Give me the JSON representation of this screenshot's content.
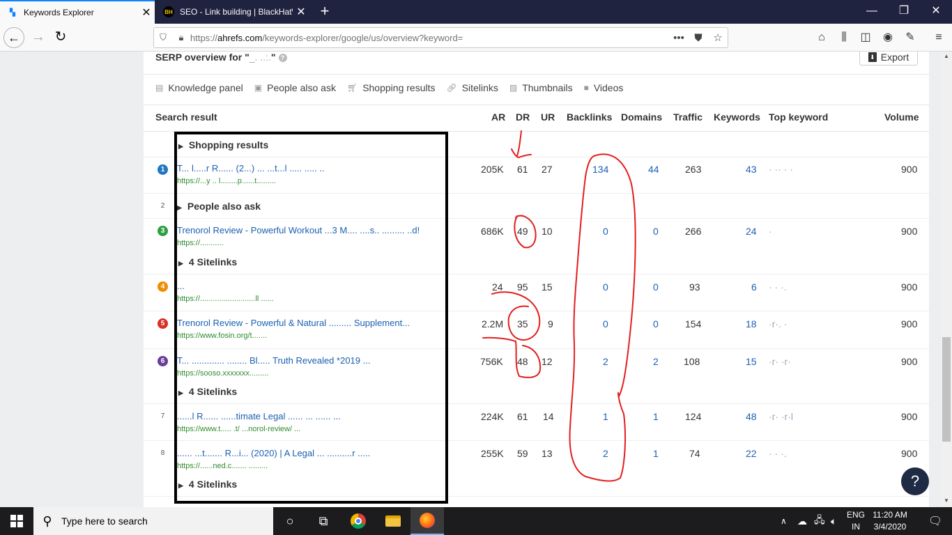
{
  "browser": {
    "tabs": [
      {
        "title": "Keywords Explorer",
        "icon": "ahrefs-icon"
      },
      {
        "title": "SEO - Link building | BlackHatW",
        "icon": "blackhatworld-icon"
      }
    ],
    "url_prefix": "https://",
    "url_domain": "ahrefs.com",
    "url_rest": "/keywords-explorer/google/us/overview?keyword="
  },
  "serp": {
    "title": "SERP overview for \"",
    "title_suffix": "\"",
    "export_label": "Export",
    "features": [
      {
        "label": "Knowledge panel",
        "icon": "knowledge-panel-icon"
      },
      {
        "label": "People also ask",
        "icon": "people-also-ask-icon"
      },
      {
        "label": "Shopping results",
        "icon": "shopping-cart-icon"
      },
      {
        "label": "Sitelinks",
        "icon": "link-icon"
      },
      {
        "label": "Thumbnails",
        "icon": "image-icon"
      },
      {
        "label": "Videos",
        "icon": "video-icon"
      }
    ],
    "columns": {
      "search_result": "Search result",
      "ar": "AR",
      "dr": "DR",
      "ur": "UR",
      "backlinks": "Backlinks",
      "domains": "Domains",
      "traffic": "Traffic",
      "keywords": "Keywords",
      "top_keyword": "Top keyword",
      "volume": "Volume"
    },
    "feature_rows": {
      "shopping": "Shopping results",
      "paa": "People also ask",
      "sitelinks": "4 Sitelinks"
    },
    "results": [
      {
        "rank": "1",
        "title": "T... l.....r R...... (2...) ... ...t...l ..... ..... ..",
        "url": "https://...y .. l........p......t.........",
        "ar": "205K",
        "dr": "61",
        "ur": "27",
        "backlinks": "134",
        "domains": "44",
        "traffic": "263",
        "keywords": "43",
        "volume": "900"
      },
      {
        "rank": "2"
      },
      {
        "rank": "3",
        "title": "Trenorol Review - Powerful Workout ...3 M.... ....s.. ......... ..d!",
        "url": "https://...........",
        "ar": "686K",
        "dr": "49",
        "ur": "10",
        "backlinks": "0",
        "domains": "0",
        "traffic": "266",
        "keywords": "24",
        "volume": "900"
      },
      {
        "rank": "4",
        "title": "...",
        "url": "https://..........................ll ......",
        "ar": "24",
        "dr": "95",
        "ur": "15",
        "backlinks": "0",
        "domains": "0",
        "traffic": "93",
        "keywords": "6",
        "volume": "900"
      },
      {
        "rank": "5",
        "title": "Trenorol Review - Powerful & Natural ......... Supplement...",
        "url": "https://www.fosin.org/t.......",
        "ar": "2.2M",
        "dr": "35",
        "ur": "9",
        "backlinks": "0",
        "domains": "0",
        "traffic": "154",
        "keywords": "18",
        "volume": "900"
      },
      {
        "rank": "6",
        "title": "T...  ............. ........ Bl..... Truth Revealed *2019 ...",
        "url": "https://sooso.xxxxxxx.........",
        "ar": "756K",
        "dr": "48",
        "ur": "12",
        "backlinks": "2",
        "domains": "2",
        "traffic": "108",
        "keywords": "15",
        "volume": "900"
      },
      {
        "rank": "7",
        "title": "......l R...... ......timate Legal ...... ... ...... ...",
        "url": "https://www.t..... .t/ ...norol-review/ ...",
        "ar": "224K",
        "dr": "61",
        "ur": "14",
        "backlinks": "1",
        "domains": "1",
        "traffic": "124",
        "keywords": "48",
        "volume": "900"
      },
      {
        "rank": "8",
        "title": "...... ...t....... R...i... (2020) | A Legal ... ..........r .....",
        "url": "https://......ned.c....... .........",
        "ar": "255K",
        "dr": "59",
        "ur": "13",
        "backlinks": "2",
        "domains": "1",
        "traffic": "74",
        "keywords": "22",
        "volume": "900"
      }
    ]
  },
  "help_label": "?",
  "taskbar": {
    "search_placeholder": "Type here to search",
    "lang_top": "ENG",
    "lang_bottom": "IN",
    "time": "11:20 AM",
    "date": "3/4/2020"
  },
  "colors": {
    "rank1": "#1f78c1",
    "rank3": "#2ea043",
    "rank4": "#f08c00",
    "rank5": "#d93025",
    "rank6": "#6a3d9a",
    "annotation": "#e31e1e",
    "link": "#1a5fb4"
  }
}
